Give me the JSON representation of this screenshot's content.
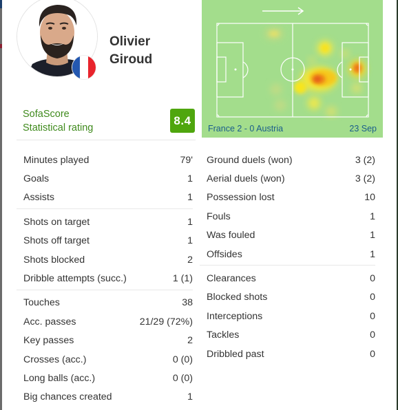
{
  "player": {
    "first_name": "Olivier",
    "last_name": "Giroud",
    "nationality_flag": "france-flag",
    "avatar": "player-photo"
  },
  "rating": {
    "label_line1": "SofaScore",
    "label_line2": "Statistical rating",
    "value": "8.4",
    "color": "#4fa60e"
  },
  "heatmap": {
    "attack_direction": "arrow-right-icon",
    "match": "France 2 - 0 Austria",
    "date": "23 Sep",
    "pitch_color": "#a3dd8c"
  },
  "stats_left": [
    [
      {
        "label": "Minutes played",
        "value": "79'"
      },
      {
        "label": "Goals",
        "value": "1"
      },
      {
        "label": "Assists",
        "value": "1"
      }
    ],
    [
      {
        "label": "Shots on target",
        "value": "1"
      },
      {
        "label": "Shots off target",
        "value": "1"
      },
      {
        "label": "Shots blocked",
        "value": "2"
      },
      {
        "label": "Dribble attempts (succ.)",
        "value": "1 (1)"
      }
    ],
    [
      {
        "label": "Touches",
        "value": "38"
      },
      {
        "label": "Acc. passes",
        "value": "21/29 (72%)"
      },
      {
        "label": "Key passes",
        "value": "2"
      },
      {
        "label": "Crosses (acc.)",
        "value": "0 (0)"
      },
      {
        "label": "Long balls (acc.)",
        "value": "0 (0)"
      },
      {
        "label": "Big chances created",
        "value": "1"
      }
    ]
  ],
  "stats_right": [
    [
      {
        "label": "Ground duels (won)",
        "value": "3 (2)"
      },
      {
        "label": "Aerial duels (won)",
        "value": "3 (2)"
      },
      {
        "label": "Possession lost",
        "value": "10"
      },
      {
        "label": "Fouls",
        "value": "1"
      },
      {
        "label": "Was fouled",
        "value": "1"
      },
      {
        "label": "Offsides",
        "value": "1"
      }
    ],
    [
      {
        "label": "Clearances",
        "value": "0"
      },
      {
        "label": "Blocked shots",
        "value": "0"
      },
      {
        "label": "Interceptions",
        "value": "0"
      },
      {
        "label": "Tackles",
        "value": "0"
      },
      {
        "label": "Dribbled past",
        "value": "0"
      }
    ]
  ]
}
